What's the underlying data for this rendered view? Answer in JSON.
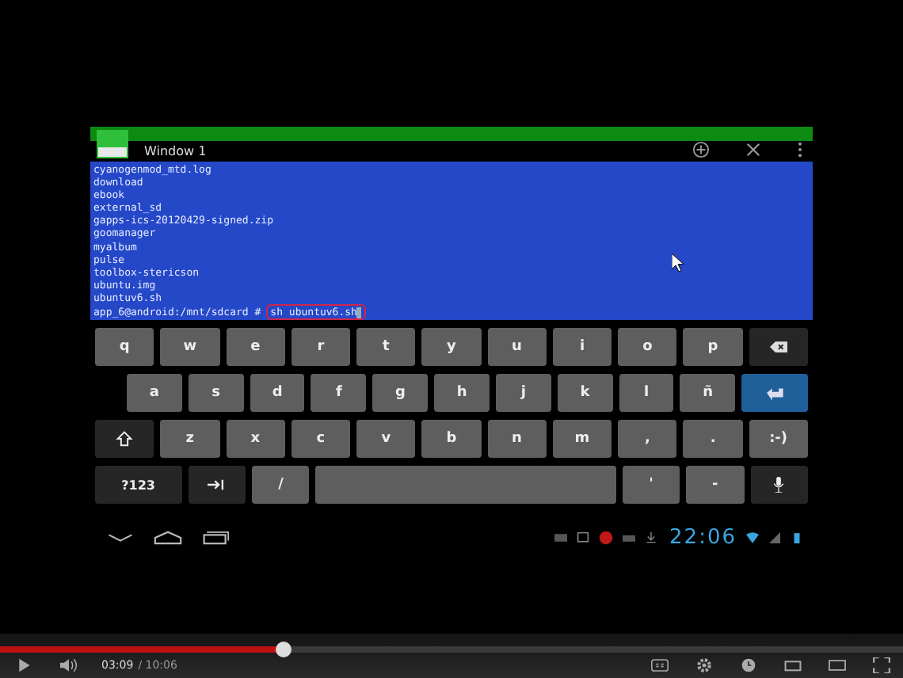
{
  "video": {
    "window": {
      "title": "Window 1"
    },
    "terminal": {
      "lines": [
        "cyanogenmod_mtd.log",
        "download",
        "ebook",
        "external_sd",
        "gapps-ics-20120429-signed.zip",
        "goomanager",
        "myalbum",
        "pulse",
        "toolbox-stericson",
        "ubuntu.img",
        "ubuntuv6.sh"
      ],
      "prompt": "app_6@android:/mnt/sdcard #",
      "command": "sh ubuntuv6.sh"
    },
    "keyboard": {
      "rows": [
        [
          {
            "kind": "char",
            "label": "q"
          },
          {
            "kind": "char",
            "label": "w"
          },
          {
            "kind": "char",
            "label": "e"
          },
          {
            "kind": "char",
            "label": "r"
          },
          {
            "kind": "char",
            "label": "t"
          },
          {
            "kind": "char",
            "label": "y"
          },
          {
            "kind": "char",
            "label": "u"
          },
          {
            "kind": "char",
            "label": "i"
          },
          {
            "kind": "char",
            "label": "o"
          },
          {
            "kind": "char",
            "label": "p"
          },
          {
            "kind": "backspace"
          }
        ],
        [
          {
            "kind": "char",
            "label": "a"
          },
          {
            "kind": "char",
            "label": "s"
          },
          {
            "kind": "char",
            "label": "d"
          },
          {
            "kind": "char",
            "label": "f"
          },
          {
            "kind": "char",
            "label": "g"
          },
          {
            "kind": "char",
            "label": "h"
          },
          {
            "kind": "char",
            "label": "j"
          },
          {
            "kind": "char",
            "label": "k"
          },
          {
            "kind": "char",
            "label": "l"
          },
          {
            "kind": "char",
            "label": "ñ"
          },
          {
            "kind": "enter"
          }
        ],
        [
          {
            "kind": "shift"
          },
          {
            "kind": "char",
            "label": "z"
          },
          {
            "kind": "char",
            "label": "x"
          },
          {
            "kind": "char",
            "label": "c"
          },
          {
            "kind": "char",
            "label": "v"
          },
          {
            "kind": "char",
            "label": "b"
          },
          {
            "kind": "char",
            "label": "n"
          },
          {
            "kind": "char",
            "label": "m"
          },
          {
            "kind": "char",
            "label": ","
          },
          {
            "kind": "char",
            "label": "."
          },
          {
            "kind": "char",
            "label": ":-)"
          }
        ],
        [
          {
            "kind": "fn",
            "label": "?123"
          },
          {
            "kind": "tab"
          },
          {
            "kind": "char",
            "label": "/"
          },
          {
            "kind": "space"
          },
          {
            "kind": "char",
            "label": "'"
          },
          {
            "kind": "char",
            "label": "-"
          },
          {
            "kind": "mic"
          }
        ]
      ]
    },
    "status_bar": {
      "time": "22:06"
    }
  },
  "player": {
    "progress": {
      "level": 0.314
    },
    "current_time": "03:09",
    "duration": "/ 10:06"
  }
}
